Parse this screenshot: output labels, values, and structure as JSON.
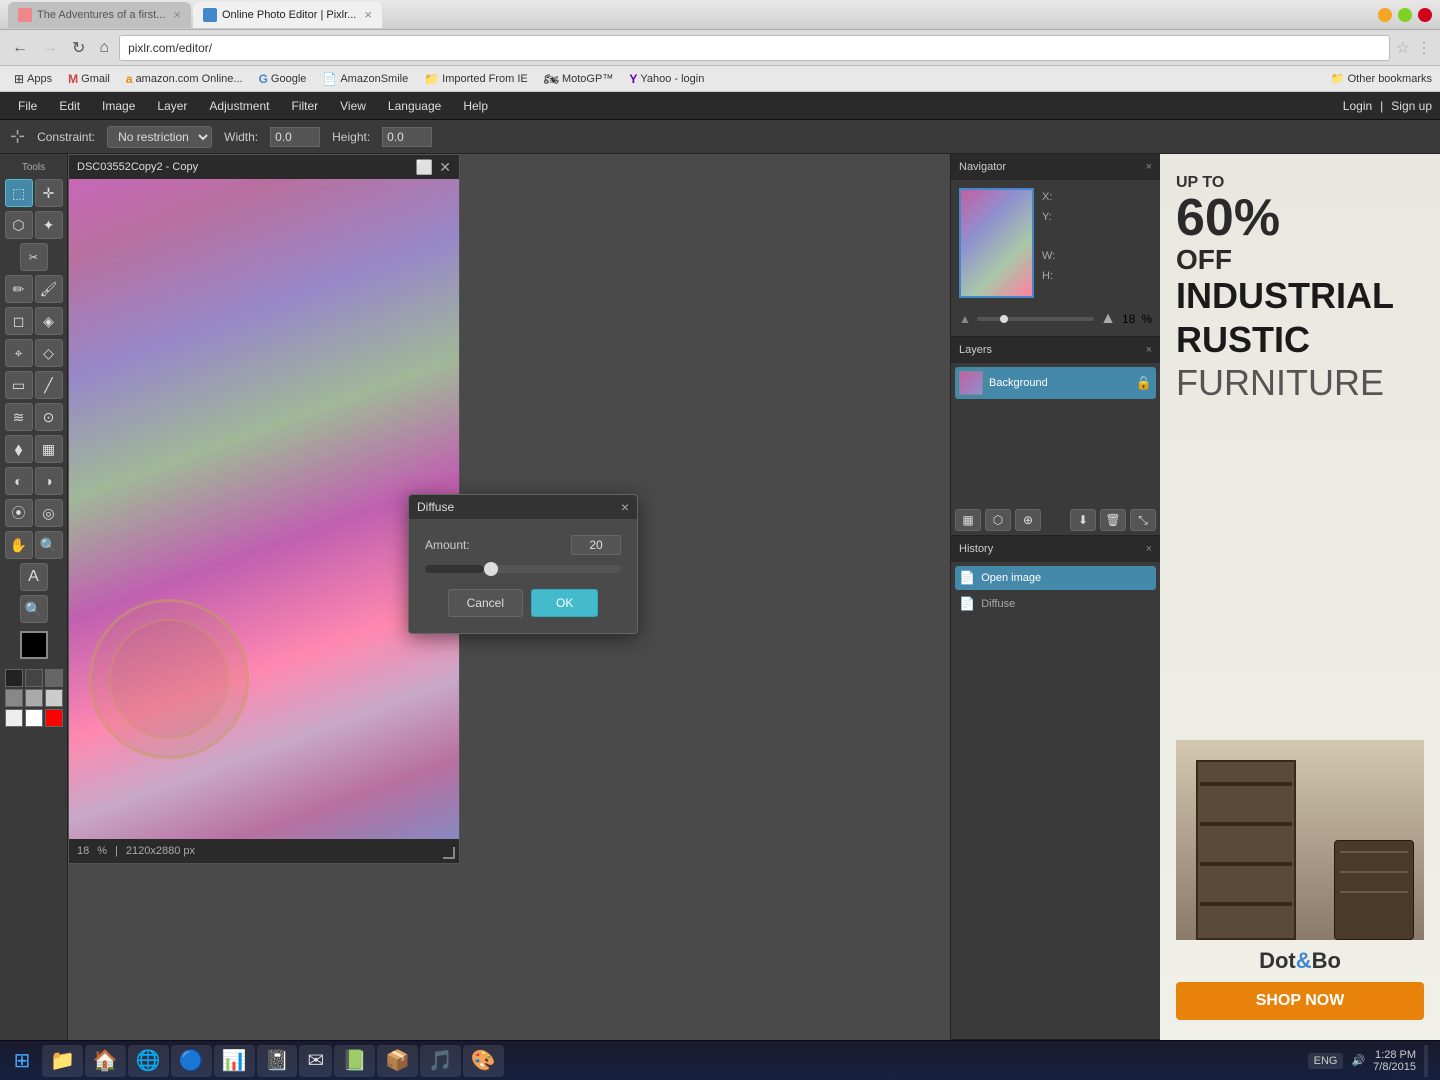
{
  "browser": {
    "tabs": [
      {
        "id": "tab1",
        "label": "The Adventures of a first...",
        "favicon": "book",
        "active": false
      },
      {
        "id": "tab2",
        "label": "Online Photo Editor | Pixlr...",
        "favicon": "photo",
        "active": true
      }
    ],
    "address": "pixlr.com/editor/",
    "bookmarks": [
      {
        "id": "apps",
        "label": "Apps",
        "icon": "⊞"
      },
      {
        "id": "gmail",
        "label": "Gmail",
        "icon": "M"
      },
      {
        "id": "amazon",
        "label": "amazon.com Online...",
        "icon": "a"
      },
      {
        "id": "google",
        "label": "Google",
        "icon": "G"
      },
      {
        "id": "amazonsmile",
        "label": "AmazonSmile",
        "icon": "📄"
      },
      {
        "id": "imported",
        "label": "Imported From IE",
        "icon": "📁"
      },
      {
        "id": "motogp",
        "label": "MotoGP™",
        "icon": "🏍"
      },
      {
        "id": "yahoo",
        "label": "Yahoo - login",
        "icon": "Y"
      }
    ],
    "bookmarks_other": "Other bookmarks"
  },
  "app": {
    "title": "Pixlr Editor",
    "menu": [
      "File",
      "Edit",
      "Image",
      "Layer",
      "Adjustment",
      "Filter",
      "View",
      "Language",
      "Help"
    ],
    "menu_right": [
      "Login",
      "|",
      "Sign up"
    ],
    "toolbar": {
      "constraint_label": "Constraint:",
      "constraint_value": "No restriction",
      "width_label": "Width:",
      "width_value": "0.0",
      "height_label": "Height:",
      "height_value": "0.0"
    }
  },
  "canvas_window": {
    "title": "DSC03552Copy2 - Copy",
    "zoom": "18",
    "dimensions": "2120x2880 px",
    "zoom_unit": "%"
  },
  "navigator": {
    "title": "Navigator",
    "x_label": "X:",
    "y_label": "Y:",
    "w_label": "W:",
    "h_label": "H:",
    "zoom_value": "18",
    "zoom_unit": "%"
  },
  "layers": {
    "title": "Layers",
    "items": [
      {
        "name": "Background",
        "locked": true
      }
    ]
  },
  "history": {
    "title": "History",
    "items": [
      {
        "name": "Open image",
        "active": true
      },
      {
        "name": "Diffuse",
        "active": false
      }
    ]
  },
  "dialog": {
    "title": "Diffuse",
    "amount_label": "Amount:",
    "amount_value": "20",
    "cancel_label": "Cancel",
    "ok_label": "OK"
  },
  "tools": {
    "label": "Tools"
  },
  "ad": {
    "upto": "UP TO",
    "percent": "60%",
    "off": "OFF",
    "heading1": "INDUSTRIAL",
    "heading2": "RUSTIC",
    "heading3": "FURNITURE",
    "logo": "Dot&Bo",
    "shop_btn": "SHOP NOW"
  },
  "taskbar": {
    "time": "1:28 PM",
    "date": "7/8/2015",
    "lang": "ENG"
  }
}
